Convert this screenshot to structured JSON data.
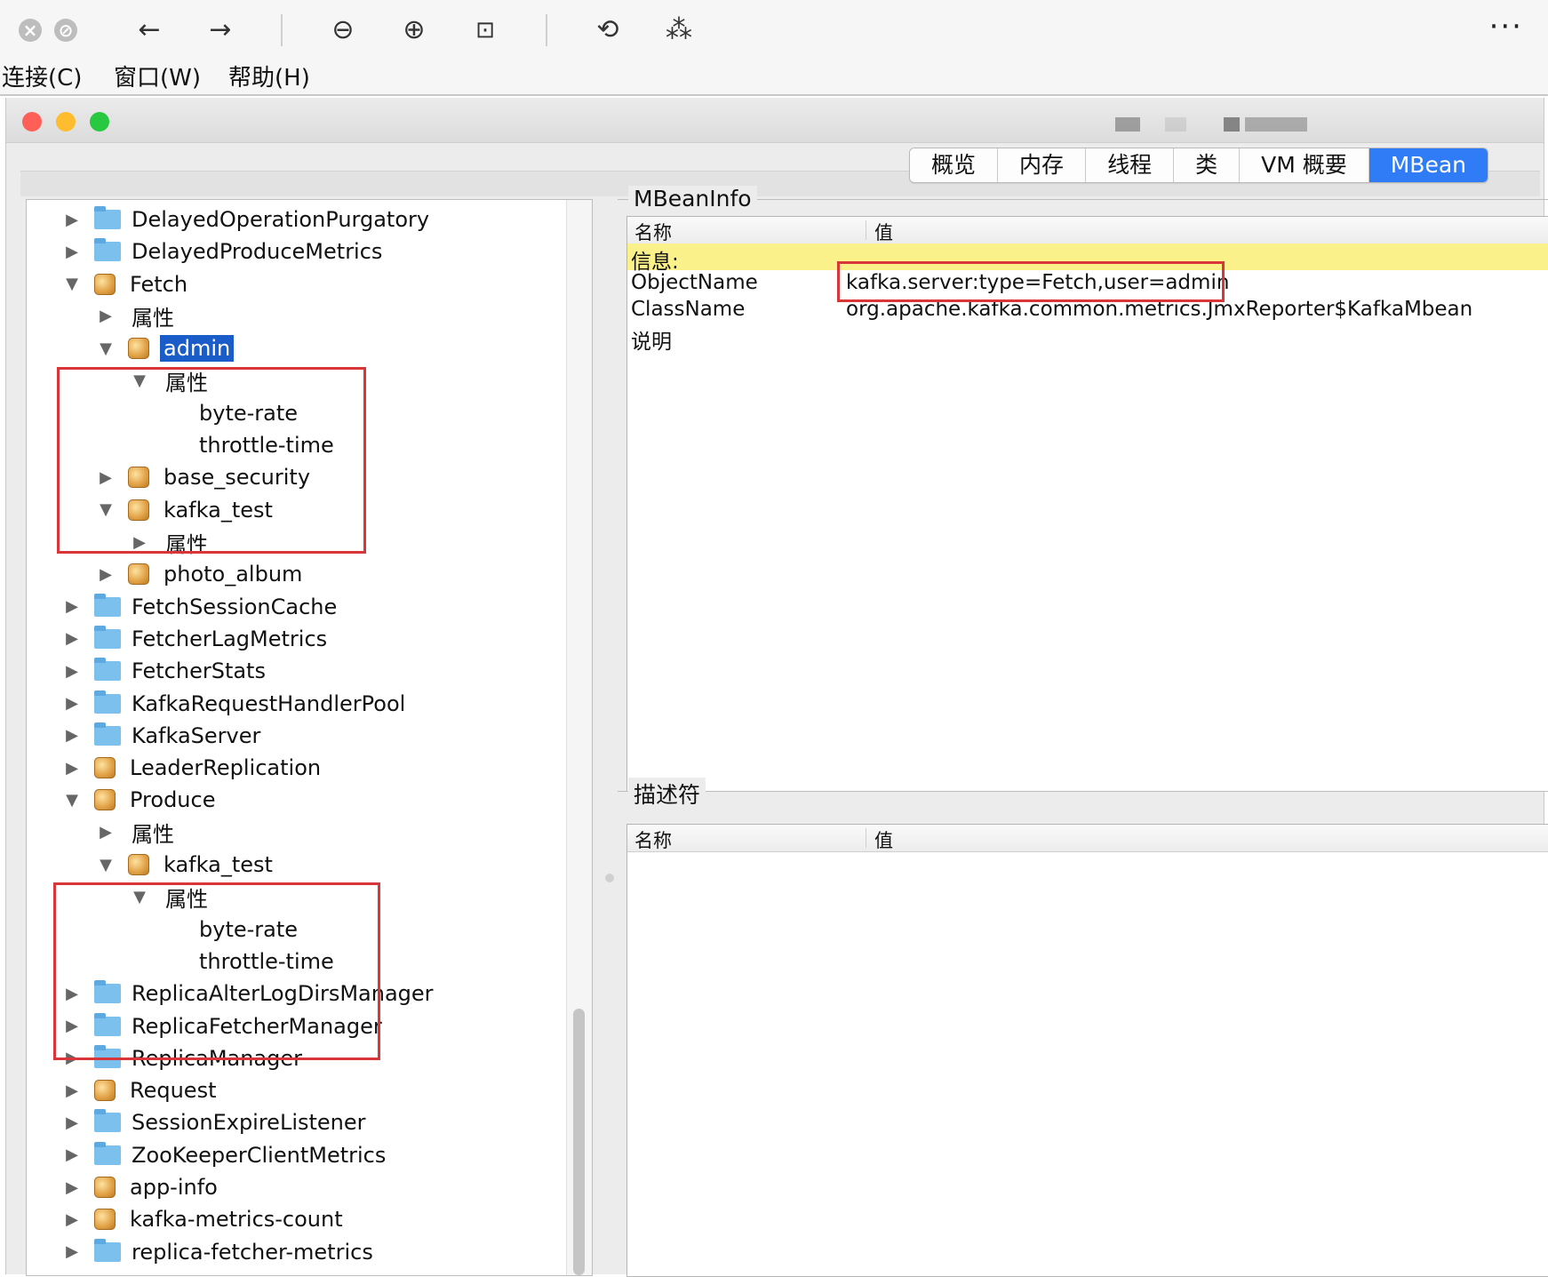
{
  "toolbar": {
    "close_icon": "x-circle-icon",
    "stop_icon": "stop-circle-icon",
    "back_icon": "arrow-left-icon",
    "forward_icon": "arrow-right-icon",
    "zoom_out_icon": "zoom-out-icon",
    "zoom_in_icon": "zoom-in-icon",
    "actual_size_icon": "actual-size-icon",
    "rotate_icon": "rotate-icon",
    "magic_icon": "magic-wand-icon",
    "more_label": "···"
  },
  "menu": [
    "连接(C)",
    "窗口(W)",
    "帮助(H)"
  ],
  "tabs": [
    "概览",
    "内存",
    "线程",
    "类",
    "VM 概要",
    "MBean"
  ],
  "active_tab": "MBean",
  "tree": [
    {
      "label": "DelayedOperationPurgatory",
      "icon": "folder-icon",
      "depth": 0,
      "arrow": "collapsed"
    },
    {
      "label": "DelayedProduceMetrics",
      "icon": "folder-icon",
      "depth": 0,
      "arrow": "collapsed"
    },
    {
      "label": "Fetch",
      "icon": "bean-icon",
      "depth": 0,
      "arrow": "expanded"
    },
    {
      "label": "属性",
      "icon": "",
      "depth": 1,
      "arrow": "collapsed"
    },
    {
      "label": "admin",
      "icon": "bean-icon",
      "depth": 1,
      "arrow": "expanded",
      "selected": true
    },
    {
      "label": "属性",
      "icon": "",
      "depth": 2,
      "arrow": "expanded"
    },
    {
      "label": "byte-rate",
      "icon": "",
      "depth": 3,
      "arrow": "none"
    },
    {
      "label": "throttle-time",
      "icon": "",
      "depth": 3,
      "arrow": "none"
    },
    {
      "label": "base_security",
      "icon": "bean-icon",
      "depth": 1,
      "arrow": "collapsed"
    },
    {
      "label": "kafka_test",
      "icon": "bean-icon",
      "depth": 1,
      "arrow": "expanded"
    },
    {
      "label": "属性",
      "icon": "",
      "depth": 2,
      "arrow": "collapsed"
    },
    {
      "label": "photo_album",
      "icon": "bean-icon",
      "depth": 1,
      "arrow": "collapsed"
    },
    {
      "label": "FetchSessionCache",
      "icon": "folder-icon",
      "depth": 0,
      "arrow": "collapsed"
    },
    {
      "label": "FetcherLagMetrics",
      "icon": "folder-icon",
      "depth": 0,
      "arrow": "collapsed"
    },
    {
      "label": "FetcherStats",
      "icon": "folder-icon",
      "depth": 0,
      "arrow": "collapsed"
    },
    {
      "label": "KafkaRequestHandlerPool",
      "icon": "folder-icon",
      "depth": 0,
      "arrow": "collapsed"
    },
    {
      "label": "KafkaServer",
      "icon": "folder-icon",
      "depth": 0,
      "arrow": "collapsed"
    },
    {
      "label": "LeaderReplication",
      "icon": "bean-icon",
      "depth": 0,
      "arrow": "collapsed"
    },
    {
      "label": "Produce",
      "icon": "bean-icon",
      "depth": 0,
      "arrow": "expanded"
    },
    {
      "label": "属性",
      "icon": "",
      "depth": 1,
      "arrow": "collapsed"
    },
    {
      "label": "kafka_test",
      "icon": "bean-icon",
      "depth": 1,
      "arrow": "expanded"
    },
    {
      "label": "属性",
      "icon": "",
      "depth": 2,
      "arrow": "expanded"
    },
    {
      "label": "byte-rate",
      "icon": "",
      "depth": 3,
      "arrow": "none"
    },
    {
      "label": "throttle-time",
      "icon": "",
      "depth": 3,
      "arrow": "none"
    },
    {
      "label": "ReplicaAlterLogDirsManager",
      "icon": "folder-icon",
      "depth": 0,
      "arrow": "collapsed"
    },
    {
      "label": "ReplicaFetcherManager",
      "icon": "folder-icon",
      "depth": 0,
      "arrow": "collapsed"
    },
    {
      "label": "ReplicaManager",
      "icon": "folder-icon",
      "depth": 0,
      "arrow": "collapsed"
    },
    {
      "label": "Request",
      "icon": "bean-icon",
      "depth": 0,
      "arrow": "collapsed"
    },
    {
      "label": "SessionExpireListener",
      "icon": "folder-icon",
      "depth": 0,
      "arrow": "collapsed"
    },
    {
      "label": "ZooKeeperClientMetrics",
      "icon": "folder-icon",
      "depth": 0,
      "arrow": "collapsed"
    },
    {
      "label": "app-info",
      "icon": "bean-icon",
      "depth": 0,
      "arrow": "collapsed"
    },
    {
      "label": "kafka-metrics-count",
      "icon": "bean-icon",
      "depth": 0,
      "arrow": "collapsed"
    },
    {
      "label": "replica-fetcher-metrics",
      "icon": "folder-icon",
      "depth": 0,
      "arrow": "collapsed"
    }
  ],
  "mbean_info": {
    "title": "MBeanInfo",
    "col_name": "名称",
    "col_value": "值",
    "info_label": "信息:",
    "rows": [
      {
        "name": "ObjectName",
        "value": "kafka.server:type=Fetch,user=admin"
      },
      {
        "name": "ClassName",
        "value": "org.apache.kafka.common.metrics.JmxReporter$KafkaMbean"
      },
      {
        "name": "说明",
        "value": ""
      }
    ]
  },
  "descriptor": {
    "title": "描述符",
    "col_name": "名称",
    "col_value": "值"
  },
  "colors": {
    "accent": "#2f7cf6",
    "selection": "#1a5cc8",
    "highlight_box": "#d9363a",
    "info_row": "#fbf18a"
  }
}
